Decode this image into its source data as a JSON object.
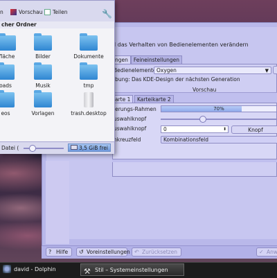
{
  "dolphin": {
    "toolbar": {
      "left_label": "n",
      "preview_label": "Vorschau",
      "split_label": "Teilen"
    },
    "breadcrumb": "cher Ordner",
    "files": [
      {
        "name": "fläche",
        "icon": "folder-desktop-icon"
      },
      {
        "name": "Bilder",
        "icon": "folder-pictures-icon"
      },
      {
        "name": "Dokumente",
        "icon": "folder-documents-icon"
      },
      {
        "name": "oads",
        "icon": "folder-downloads-icon"
      },
      {
        "name": "Musik",
        "icon": "folder-music-icon"
      },
      {
        "name": "tmp",
        "icon": "folder-icon"
      },
      {
        "name": "eos",
        "icon": "folder-videos-icon"
      },
      {
        "name": "Vorlagen",
        "icon": "folder-templates-icon"
      },
      {
        "name": "trash.desktop",
        "icon": "trash-icon"
      }
    ],
    "status": {
      "label": "Datei (",
      "free_space": "3,5 GiB frei",
      "zoom_fraction": 0.15
    }
  },
  "settings": {
    "heading": "d das Verhalten von Bedienelementen verändern",
    "tabs": [
      "ngen",
      "Feineinstellungen"
    ],
    "widget_style_label": "Bedienelemente:",
    "widget_style_value": "Oxygen",
    "description": "ibung: Das KDE-Design der nächsten Generation",
    "preview_label": "Vorschau",
    "sub_tabs": [
      "arte 1",
      "Karteikarte 2"
    ],
    "rows": {
      "progress_label": "ierungs-Rahmen",
      "progress_value": 0.7,
      "progress_text": "70%",
      "slider_label": "uswahlknopf",
      "slider_value": 0.35,
      "spin_label": "uswahlknopf",
      "spin_value": "0",
      "button_label": "Knopf",
      "combo_label": "nkreuzfeld",
      "combo_value": "Kombinationsfeld"
    },
    "bottom_buttons": {
      "help": "Hilfe",
      "defaults": "Voreinstellungen",
      "reset": "Zurücksetzen",
      "apply": "Anw"
    }
  },
  "taskbar": {
    "items": [
      {
        "label": "david - Dolphin",
        "icon": "dolphin-icon"
      },
      {
        "label": "Stil – Systemeinstellungen",
        "icon": "system-settings-icon"
      }
    ]
  }
}
